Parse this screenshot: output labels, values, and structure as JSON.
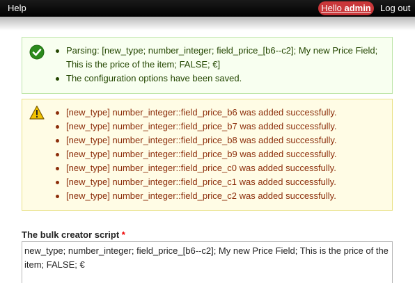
{
  "toolbar": {
    "help_label": "Help",
    "hello_prefix": "Hello",
    "username": "admin",
    "logout_label": "Log out"
  },
  "status_message": {
    "icon": "check-circle-icon",
    "items": [
      "Parsing: [new_type; number_integer; field_price_[b6--c2]; My new Price Field; This is the price of the item; FALSE; €]",
      "The configuration options have been saved."
    ]
  },
  "warning_message": {
    "icon": "warning-triangle-icon",
    "items": [
      "[new_type] number_integer::field_price_b6 was added successfully.",
      "[new_type] number_integer::field_price_b7 was added successfully.",
      "[new_type] number_integer::field_price_b8 was added successfully.",
      "[new_type] number_integer::field_price_b9 was added successfully.",
      "[new_type] number_integer::field_price_c0 was added successfully.",
      "[new_type] number_integer::field_price_c1 was added successfully.",
      "[new_type] number_integer::field_price_c2 was added successfully."
    ]
  },
  "bulk_creator": {
    "label": "The bulk creator script",
    "required_marker": "*",
    "value": "new_type; number_integer; field_price_[b6--c2]; My new Price Field; This is the price of the item; FALSE; €"
  },
  "colors": {
    "toolbar_bg": "#000000",
    "hello_badge": "#c9373a",
    "status_bg": "#f8fff0",
    "status_text": "#234600",
    "warning_bg": "#fffce5",
    "warning_text": "#8c2e0b",
    "required": "#ee0000"
  }
}
